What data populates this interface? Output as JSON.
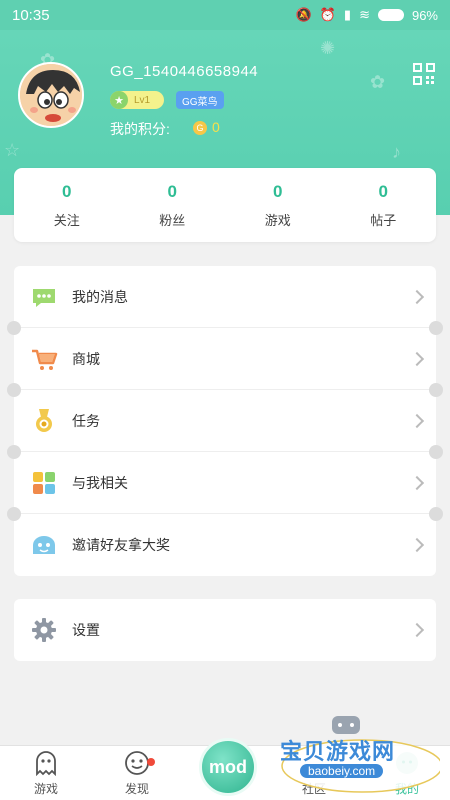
{
  "status_bar": {
    "time": "10:35",
    "battery": "96%"
  },
  "profile": {
    "username": "GG_1540446658944",
    "level_badge": "Lv1",
    "rank_badge": "GG菜鸟",
    "score_label": "我的积分:",
    "score_value": "0"
  },
  "stats": [
    {
      "value": "0",
      "label": "关注"
    },
    {
      "value": "0",
      "label": "粉丝"
    },
    {
      "value": "0",
      "label": "游戏"
    },
    {
      "value": "0",
      "label": "帖子"
    }
  ],
  "menu": [
    {
      "label": "我的消息",
      "icon": "message-icon"
    },
    {
      "label": "商城",
      "icon": "shopping-cart-icon"
    },
    {
      "label": "任务",
      "icon": "medal-icon"
    },
    {
      "label": "与我相关",
      "icon": "grid-icon"
    },
    {
      "label": "邀请好友拿大奖",
      "icon": "invite-icon"
    }
  ],
  "settings": {
    "label": "设置",
    "icon": "gear-icon"
  },
  "tabbar": {
    "games": "游戏",
    "discover": "发现",
    "mod": "mod",
    "community": "社区",
    "mine": "我的"
  },
  "watermark": {
    "title": "宝贝游戏网",
    "url": "baobeiy.com"
  },
  "colors": {
    "accent": "#5fd0b1",
    "stat_number": "#2fbd94"
  }
}
